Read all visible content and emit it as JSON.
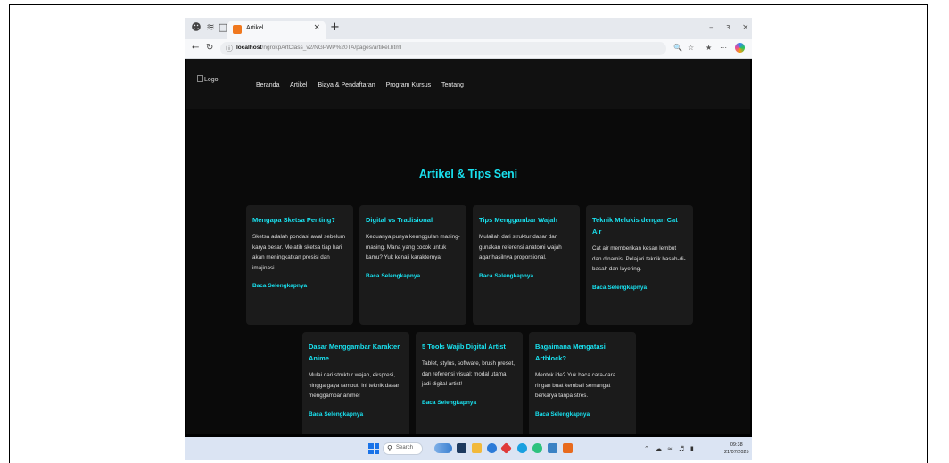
{
  "browser": {
    "tab_title": "Artikel",
    "tab_close": "×",
    "new_tab": "+",
    "url_host": "localhost",
    "url_path": "/ngrokpArtClass_v2/NGPWP%20TA/pages/artikel.html",
    "window_controls": {
      "minimize": "–",
      "restore": "ɜ",
      "close": "×"
    }
  },
  "site": {
    "logo_alt": "Logo",
    "nav": [
      "Beranda",
      "Artikel",
      "Biaya & Pendaftaran",
      "Program Kursus",
      "Tentang"
    ],
    "page_title": "Artikel & Tips Seni",
    "read_more": "Baca Selengkapnya",
    "articles": [
      {
        "title": "Mengapa Sketsa Penting?",
        "text": "Sketsa adalah pondasi awal sebelum karya besar. Melatih sketsa tiap hari akan meningkatkan presisi dan imajinasi."
      },
      {
        "title": "Digital vs Tradisional",
        "text": "Keduanya punya keunggulan masing-masing. Mana yang cocok untuk kamu? Yuk kenali karakternya!"
      },
      {
        "title": "Tips Menggambar Wajah",
        "text": "Mulailah dari struktur dasar dan gunakan referensi anatomi wajah agar hasilnya proporsional."
      },
      {
        "title": "Teknik Melukis dengan Cat Air",
        "text": "Cat air memberikan kesan lembut dan dinamis. Pelajari teknik basah-di-basah dan layering."
      },
      {
        "title": "Dasar Menggambar Karakter Anime",
        "text": "Mulai dari struktur wajah, ekspresi, hingga gaya rambut. Ini teknik dasar menggambar anime!"
      },
      {
        "title": "5 Tools Wajib Digital Artist",
        "text": "Tablet, stylus, software, brush preset, dan referensi visual: modal utama jadi digital artist!"
      },
      {
        "title": "Bagaimana Mengatasi Artblock?",
        "text": "Mentok ide? Yuk baca cara-cara ringan buat kembali semangat berkarya tanpa stres."
      }
    ]
  },
  "taskbar": {
    "search_placeholder": "Search",
    "time": "09:38",
    "date": "21/07/2025"
  },
  "colors": {
    "accent": "#19e1ef",
    "page_bg": "#0a0a0a",
    "card_bg": "#1b1b1b",
    "header_bg": "#111111"
  }
}
